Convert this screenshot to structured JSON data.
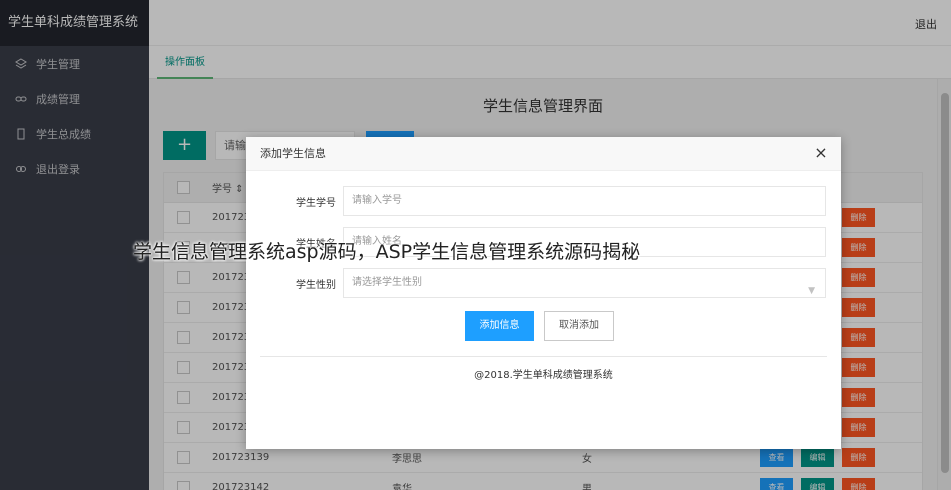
{
  "app": {
    "title": "学生单科成绩管理系统"
  },
  "sidebar": {
    "items": [
      {
        "label": "学生管理",
        "icon": "layers-icon"
      },
      {
        "label": "成绩管理",
        "icon": "link-icon"
      },
      {
        "label": "学生总成绩",
        "icon": "document-icon"
      },
      {
        "label": "退出登录",
        "icon": "chain-icon"
      }
    ]
  },
  "header": {
    "logout": "退出"
  },
  "tabs": [
    {
      "label": "操作面板"
    }
  ],
  "main": {
    "title": "学生信息管理界面",
    "add_label": "+",
    "search_placeholder": "请输"
  },
  "table": {
    "header_id": "学号 ⇕",
    "rows": [
      {
        "id": "201723",
        "name": "",
        "gender": "",
        "del": "删除"
      },
      {
        "id": "201723",
        "name": "",
        "gender": "",
        "del": "删除"
      },
      {
        "id": "201723",
        "name": "",
        "gender": "",
        "del": "删除"
      },
      {
        "id": "201723",
        "name": "",
        "gender": "",
        "del": "删除"
      },
      {
        "id": "201723",
        "name": "",
        "gender": "",
        "del": "删除"
      },
      {
        "id": "201723",
        "name": "",
        "gender": "",
        "del": "删除"
      },
      {
        "id": "201723",
        "name": "",
        "gender": "",
        "del": "删除"
      },
      {
        "id": "201723",
        "name": "",
        "gender": "",
        "del": "删除"
      },
      {
        "id": "201723139",
        "name": "李思思",
        "gender": "女",
        "view": "查看",
        "edit": "编辑",
        "del": "删除"
      },
      {
        "id": "201723142",
        "name": "袁华",
        "gender": "男",
        "view": "查看",
        "edit": "编辑",
        "del": "删除"
      }
    ]
  },
  "modal": {
    "title": "添加学生信息",
    "close": "×",
    "fields": [
      {
        "label": "学生学号",
        "placeholder": "请输入学号"
      },
      {
        "label": "学生姓名",
        "placeholder": "请输入姓名"
      },
      {
        "label": "学生性别",
        "placeholder": "请选择学生性别"
      }
    ],
    "submit": "添加信息",
    "cancel": "取消添加",
    "footer": "@2018.学生单科成绩管理系统"
  },
  "caption": "学生信息管理系统asp源码，ASP学生信息管理系统源码揭秘",
  "colors": {
    "sidebar": "#393d49",
    "accent": "#009688",
    "primary": "#1e9fff",
    "danger": "#ff5722"
  }
}
